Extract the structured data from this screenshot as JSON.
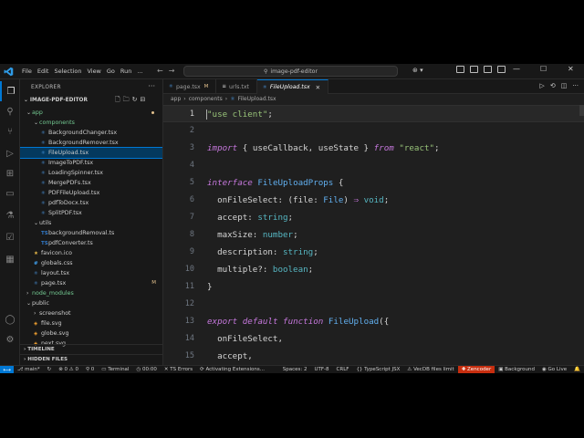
{
  "titlebar": {
    "menu": [
      "File",
      "Edit",
      "Selection",
      "View",
      "Go",
      "Run",
      "..."
    ],
    "search": "image-pdf-editor",
    "window_controls": [
      "—",
      "☐",
      "✕"
    ]
  },
  "sidebar": {
    "title": "EXPLORER",
    "project": "IMAGE-PDF-EDITOR",
    "tree": [
      {
        "label": "app",
        "type": "folder",
        "depth": 0,
        "open": true,
        "color": "t-green",
        "dot": true
      },
      {
        "label": "components",
        "type": "folder",
        "depth": 1,
        "open": true,
        "color": "t-green"
      },
      {
        "label": "BackgroundChanger.tsx",
        "type": "tsx",
        "depth": 2
      },
      {
        "label": "BackgroundRemover.tsx",
        "type": "tsx",
        "depth": 2
      },
      {
        "label": "FileUpload.tsx",
        "type": "tsx",
        "depth": 2,
        "selected": true
      },
      {
        "label": "ImageToPDF.tsx",
        "type": "tsx",
        "depth": 2
      },
      {
        "label": "LoadingSpinner.tsx",
        "type": "tsx",
        "depth": 2
      },
      {
        "label": "MergePDFs.tsx",
        "type": "tsx",
        "depth": 2
      },
      {
        "label": "PDFFileUpload.tsx",
        "type": "tsx",
        "depth": 2
      },
      {
        "label": "pdfToDocx.tsx",
        "type": "tsx",
        "depth": 2
      },
      {
        "label": "SplitPDF.tsx",
        "type": "tsx",
        "depth": 2
      },
      {
        "label": "utils",
        "type": "folder",
        "depth": 1,
        "open": true
      },
      {
        "label": "backgroundRemoval.ts",
        "type": "ts",
        "depth": 2
      },
      {
        "label": "pdfConverter.ts",
        "type": "ts",
        "depth": 2
      },
      {
        "label": "favicon.ico",
        "type": "ico",
        "depth": 1
      },
      {
        "label": "globals.css",
        "type": "css",
        "depth": 1
      },
      {
        "label": "layout.tsx",
        "type": "tsx",
        "depth": 1
      },
      {
        "label": "page.tsx",
        "type": "tsx",
        "depth": 1,
        "modified": "M"
      },
      {
        "label": "node_modules",
        "type": "folder",
        "depth": 0,
        "open": false,
        "color": "t-green"
      },
      {
        "label": "public",
        "type": "folder",
        "depth": 0,
        "open": true
      },
      {
        "label": "screenshot",
        "type": "folder",
        "depth": 1,
        "open": false
      },
      {
        "label": "file.svg",
        "type": "svg",
        "depth": 1
      },
      {
        "label": "globe.svg",
        "type": "svg",
        "depth": 1
      },
      {
        "label": "next.svg",
        "type": "svg",
        "depth": 1
      }
    ],
    "sections": [
      "TIMELINE",
      "HIDDEN FILES"
    ]
  },
  "tabs": [
    {
      "label": "page.tsx",
      "modified": "M",
      "icon": "⚛",
      "active": false
    },
    {
      "label": "urls.txt",
      "icon": "≡",
      "active": false
    },
    {
      "label": "FileUpload.tsx",
      "icon": "⚛",
      "active": true,
      "close": "✕"
    }
  ],
  "breadcrumb": [
    "app",
    "components",
    "FileUpload.tsx"
  ],
  "editor": {
    "lines": [
      {
        "n": "1",
        "html": "<span class='str'>\"use client\"</span>;"
      },
      {
        "n": "2",
        "html": ""
      },
      {
        "n": "3",
        "html": "<span class='kwi'>import</span> { <span class='br'>useCallback</span>, <span class='br'>useState</span> } <span class='kwi'>from</span> <span class='str'>\"react\"</span>;"
      },
      {
        "n": "4",
        "html": ""
      },
      {
        "n": "5",
        "html": "<span class='kwi'>interface</span> <span class='ty'>FileUploadProps</span> {"
      },
      {
        "n": "6",
        "html": "  onFileSelect: (<span class='br'>file</span>: <span class='ty'>File</span>) <span class='kw'>⇒</span> <span class='typ'>void</span>;"
      },
      {
        "n": "7",
        "html": "  accept: <span class='typ'>string</span>;"
      },
      {
        "n": "8",
        "html": "  maxSize: <span class='typ'>number</span>;"
      },
      {
        "n": "9",
        "html": "  description: <span class='typ'>string</span>;"
      },
      {
        "n": "10",
        "html": "  multiple?: <span class='typ'>boolean</span>;"
      },
      {
        "n": "11",
        "html": "}"
      },
      {
        "n": "12",
        "html": ""
      },
      {
        "n": "13",
        "html": "<span class='kwi'>export</span> <span class='kwi'>default</span> <span class='kwi'>function</span> <span class='fn'>FileUpload</span>({"
      },
      {
        "n": "14",
        "html": "  onFileSelect,"
      },
      {
        "n": "15",
        "html": "  accept,"
      }
    ]
  },
  "statusbar": {
    "remote": "⟷",
    "items": [
      {
        "name": "branch",
        "label": "⎇ main*"
      },
      {
        "name": "sync",
        "label": "↻"
      },
      {
        "name": "problems",
        "label": "⊗ 0 ⚠ 0"
      },
      {
        "name": "ports",
        "label": "⚲ 0"
      },
      {
        "name": "terminal",
        "label": "▭ Terminal"
      },
      {
        "name": "timer",
        "label": "◷ 00:00"
      },
      {
        "name": "ts-errors",
        "label": "✕ TS Errors"
      },
      {
        "name": "activating",
        "label": "⟳ Activating Extensions..."
      },
      {
        "name": "spaces",
        "label": "Spaces: 2"
      },
      {
        "name": "encoding",
        "label": "UTF-8"
      },
      {
        "name": "eol",
        "label": "CRLF"
      },
      {
        "name": "language",
        "label": "{} TypeScript JSX"
      },
      {
        "name": "vecdb",
        "label": "⚠ VecDB files limit"
      },
      {
        "name": "zencoder",
        "label": "✚ Zencoder",
        "zen": true
      },
      {
        "name": "background",
        "label": "▣ Background"
      },
      {
        "name": "golive",
        "label": "◉ Go Live"
      },
      {
        "name": "bell",
        "label": "🔔"
      }
    ]
  }
}
